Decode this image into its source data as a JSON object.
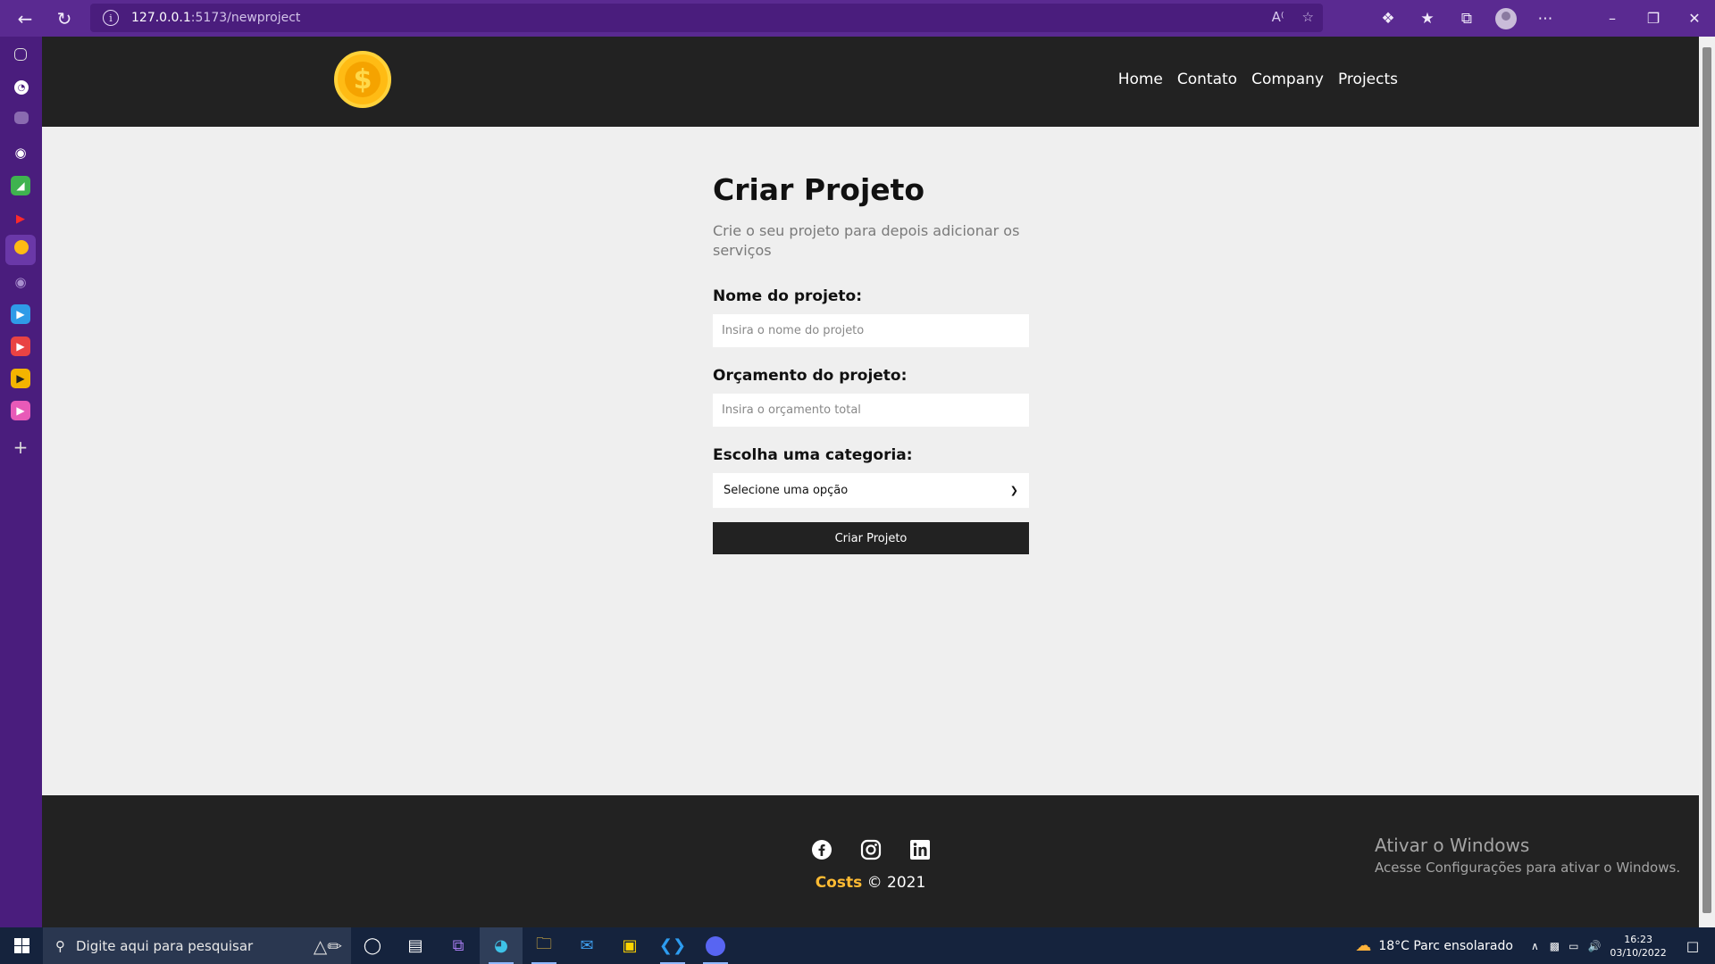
{
  "browser": {
    "url_host": "127.0.0.1",
    "url_path": ":5173/newproject"
  },
  "navbar": {
    "links": [
      "Home",
      "Contato",
      "Company",
      "Projects"
    ]
  },
  "form": {
    "title": "Criar Projeto",
    "subtitle": "Crie o seu projeto para depois adicionar os serviços",
    "name_label": "Nome do projeto:",
    "name_placeholder": "Insira o nome do projeto",
    "budget_label": "Orçamento do projeto:",
    "budget_placeholder": "Insira o orçamento total",
    "category_label": "Escolha uma categoria:",
    "category_selected": "Selecione uma opção",
    "submit_label": "Criar Projeto"
  },
  "footer": {
    "brand": "Costs",
    "copyright": " © 2021"
  },
  "watermark": {
    "line1": "Ativar o Windows",
    "line2": "Acesse Configurações para ativar o Windows."
  },
  "taskbar": {
    "search_placeholder": "Digite aqui para pesquisar",
    "weather": "18°C  Parc ensolarado",
    "time": "16:23",
    "date": "03/10/2022"
  },
  "colors": {
    "browser_frame": "#5a2a91",
    "navbar_bg": "#222222",
    "page_bg": "#efefef",
    "accent": "#ffbb33"
  }
}
